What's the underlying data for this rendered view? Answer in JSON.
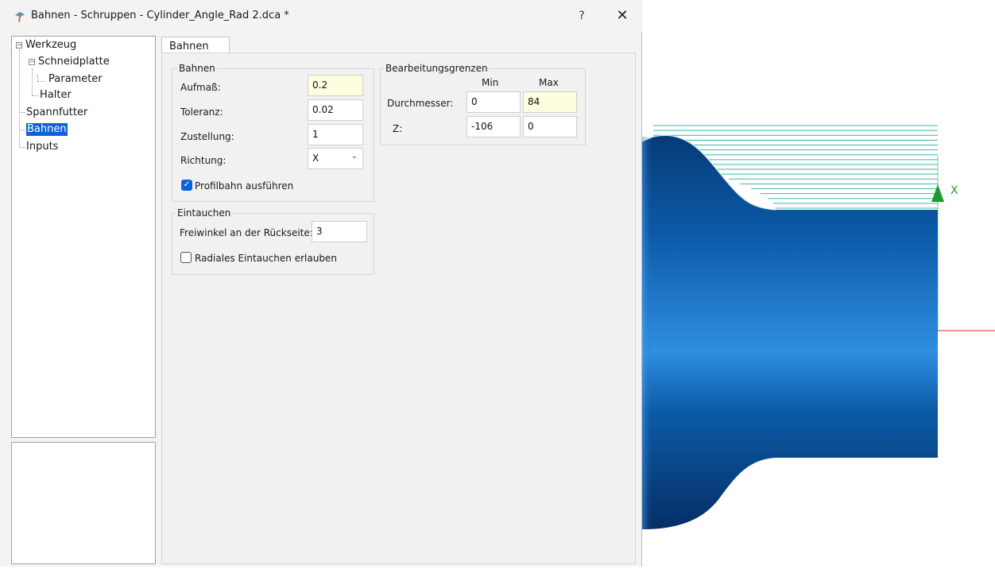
{
  "window": {
    "title": "Bahnen - Schruppen - Cylinder_Angle_Rad 2.dca *",
    "help_label": "?",
    "close_label": "✕"
  },
  "tree": {
    "items": [
      {
        "label": "Werkzeug",
        "expander": "−"
      },
      {
        "label": "Schneidplatte",
        "expander": "−"
      },
      {
        "label": "Parameter"
      },
      {
        "label": "Halter"
      },
      {
        "label": "Spannfutter"
      },
      {
        "label": "Bahnen",
        "selected": true
      },
      {
        "label": "Inputs"
      }
    ]
  },
  "tab": {
    "label": "Bahnen"
  },
  "bahnen_group": {
    "title": "Bahnen",
    "aufmass": {
      "label": "Aufmaß:",
      "value": "0.2"
    },
    "toleranz": {
      "label": "Toleranz:",
      "value": "0.02"
    },
    "zustellung": {
      "label": "Zustellung:",
      "value": "1"
    },
    "richtung": {
      "label": "Richtung:",
      "value": "X"
    },
    "profilbahn": {
      "label": "Profilbahn ausführen",
      "checked": true
    }
  },
  "grenzen_group": {
    "title": "Bearbeitungsgrenzen",
    "col_min": "Min",
    "col_max": "Max",
    "durchmesser": {
      "label": "Durchmesser:",
      "min": "0",
      "max": "84"
    },
    "z": {
      "label": "Z:",
      "min": "-106",
      "max": "0"
    }
  },
  "eintauchen_group": {
    "title": "Eintauchen",
    "freiwinkel": {
      "label": "Freiwinkel an der Rückseite:",
      "value": "3"
    },
    "radial": {
      "label": "Radiales Eintauchen erlauben",
      "checked": false
    }
  },
  "viewport": {
    "axis_label": "X",
    "part_color": "#0a5fa8",
    "toolpath_color": "#3fb6a8",
    "axis_x_color": "#1f9a2e",
    "axis_z_color": "#e02020",
    "toolpath_passes": 18
  }
}
